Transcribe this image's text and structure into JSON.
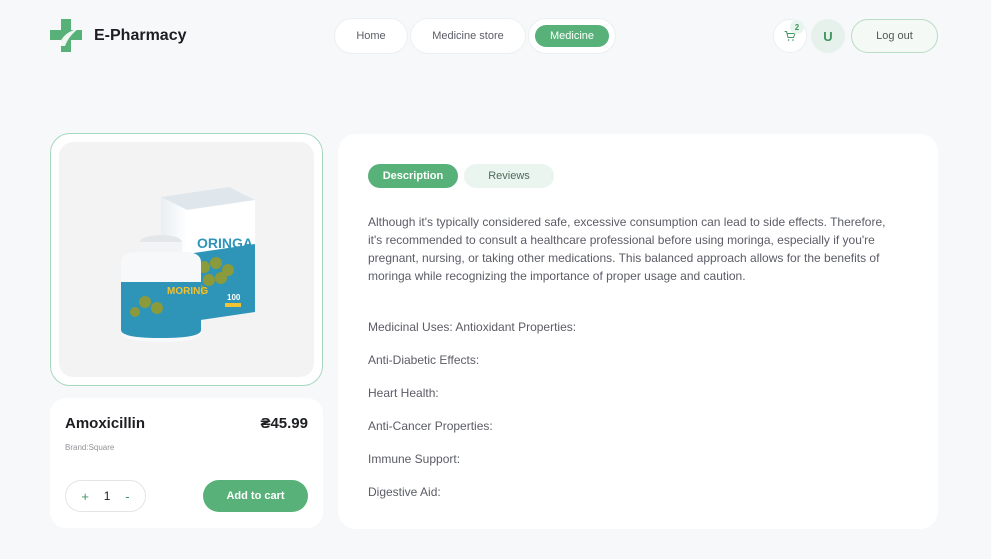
{
  "header": {
    "brand": "E-Pharmacy",
    "nav": {
      "home": "Home",
      "store": "Medicine store",
      "medicine": "Medicine"
    },
    "cart_count": "2",
    "avatar_initial": "U",
    "logout_label": "Log out"
  },
  "product": {
    "name": "Amoxicillin",
    "price": "₴45.99",
    "brand": "Brand:Square",
    "quantity": "1",
    "plus": "+",
    "minus": "-",
    "add_to_cart_label": "Add to cart",
    "image_labels": {
      "box_text": "ORINGA",
      "jar_text": "MORING",
      "count": "100"
    }
  },
  "details": {
    "tabs": [
      "Description",
      "Reviews"
    ],
    "description": "Although it's typically considered safe, excessive consumption can lead to side effects. Therefore, it's recommended to consult a healthcare professional before using moringa, especially if you're pregnant, nursing, or taking other medications. This balanced approach allows for the benefits of moringa while recognizing the importance of proper usage and caution.",
    "uses": [
      "Medicinal Uses: Antioxidant Properties:",
      "Anti-Diabetic Effects:",
      "Heart Health:",
      "Anti-Cancer Properties:",
      "Immune Support:",
      "Digestive Aid:"
    ]
  },
  "colors": {
    "accent": "#59b17a",
    "background": "#f6f8fa",
    "card": "#ffffff"
  }
}
